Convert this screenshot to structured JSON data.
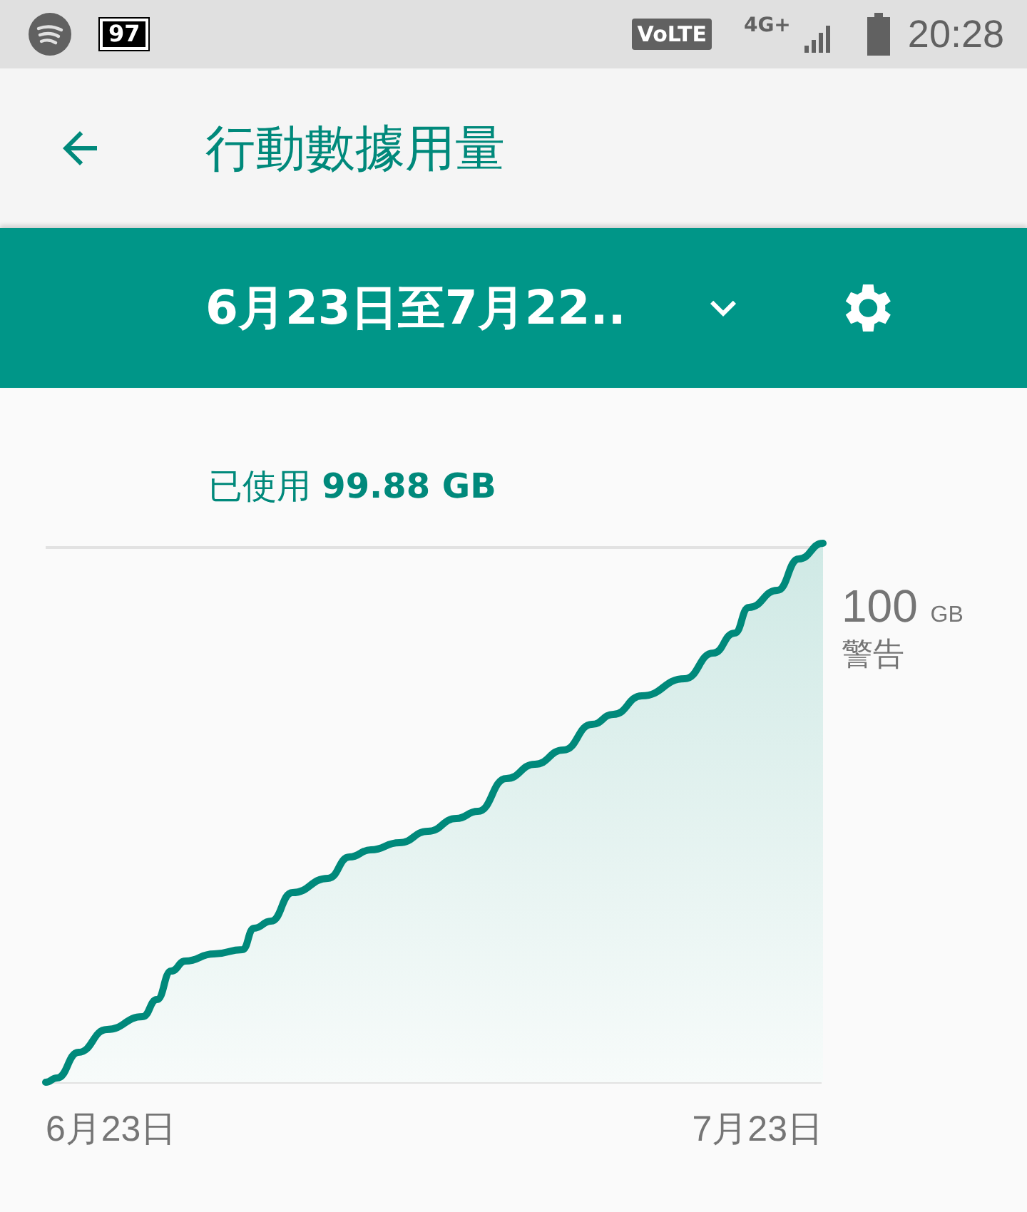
{
  "status_bar": {
    "notification_battery": "97",
    "volte": "VoLTE",
    "network": "4G+",
    "time": "20:28"
  },
  "app_bar": {
    "title": "行動數據用量"
  },
  "period_bar": {
    "period": "6月23日至7月22.."
  },
  "usage": {
    "text": "已使用 **99.88 GB**"
  },
  "chart": {
    "limit_value": "100",
    "limit_unit": "GB",
    "limit_label": "警告",
    "x_start": "6月23日",
    "x_end": "7月23日"
  }
}
